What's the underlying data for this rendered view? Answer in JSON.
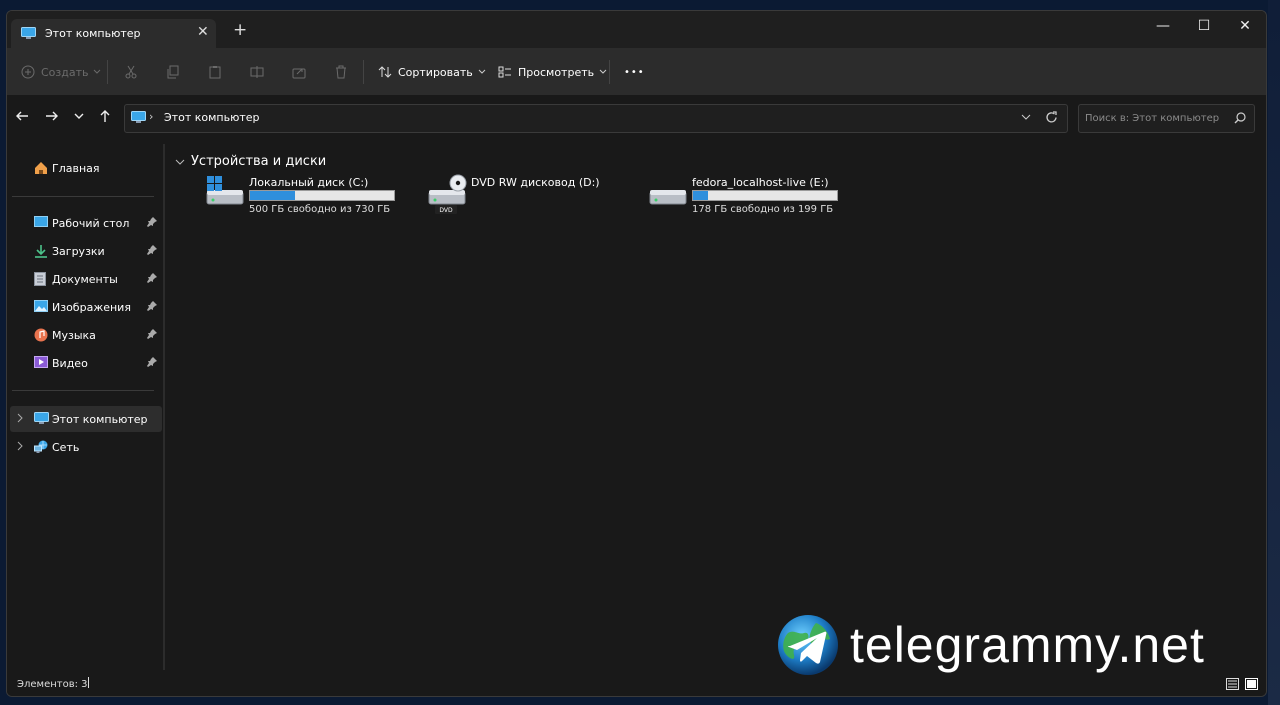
{
  "window": {
    "tab_title": "Этот компьютер",
    "new_tab": "+",
    "controls": {
      "minimize": "—",
      "maximize": "☐",
      "close": "✕"
    }
  },
  "toolbar": {
    "create_label": "Создать",
    "sort_label": "Сортировать",
    "view_label": "Просмотреть",
    "more_label": "•••"
  },
  "address": {
    "separator": "›",
    "location": "Этот компьютер"
  },
  "search": {
    "placeholder": "Поиск в: Этот компьютер"
  },
  "sidebar": {
    "home": "Главная",
    "quick": [
      {
        "label": "Рабочий стол",
        "icon": "desktop-icon"
      },
      {
        "label": "Загрузки",
        "icon": "downloads-icon"
      },
      {
        "label": "Документы",
        "icon": "documents-icon"
      },
      {
        "label": "Изображения",
        "icon": "pictures-icon"
      },
      {
        "label": "Музыка",
        "icon": "music-icon"
      },
      {
        "label": "Видео",
        "icon": "video-icon"
      }
    ],
    "this_pc": "Этот компьютер",
    "network": "Сеть"
  },
  "content": {
    "group_title": "Устройства и диски",
    "drives": [
      {
        "name": "Локальный диск (C:)",
        "free_text": "500 ГБ свободно из 730 ГБ",
        "used_fraction": 0.315
      },
      {
        "name": "DVD RW дисковод (D:)",
        "badge": "DVD"
      },
      {
        "name": "fedora_localhost-live (E:)",
        "free_text": "178 ГБ свободно из 199 ГБ",
        "used_fraction": 0.105
      }
    ]
  },
  "status": {
    "items_count": "Элементов: 3"
  },
  "watermark": {
    "text": "telegrammy.net"
  },
  "colors": {
    "accent": "#2f8fdc",
    "window_bg": "#191919",
    "toolbar_bg": "#2c2c2c"
  }
}
